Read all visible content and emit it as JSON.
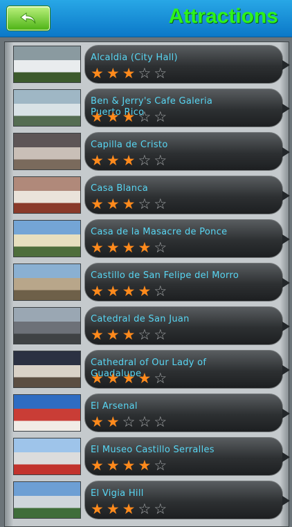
{
  "header": {
    "title": "Attractions",
    "back_icon": "back-arrow-icon"
  },
  "attractions": [
    {
      "name": "Alcaldia (City Hall)",
      "rating": 3,
      "thumb_icon": "photo-thumbnail"
    },
    {
      "name": "Ben & Jerry's Cafe Galeria Puerto Rico",
      "rating": 3,
      "thumb_icon": "photo-thumbnail"
    },
    {
      "name": "Capilla de Cristo",
      "rating": 3,
      "thumb_icon": "photo-thumbnail"
    },
    {
      "name": "Casa Blanca",
      "rating": 3,
      "thumb_icon": "photo-thumbnail"
    },
    {
      "name": "Casa de la Masacre de Ponce",
      "rating": 4,
      "thumb_icon": "photo-thumbnail"
    },
    {
      "name": "Castillo de San Felipe del Morro",
      "rating": 4,
      "thumb_icon": "photo-thumbnail"
    },
    {
      "name": "Catedral de San Juan",
      "rating": 3,
      "thumb_icon": "photo-thumbnail"
    },
    {
      "name": "Cathedral of Our Lady of Guadalupe",
      "rating": 4,
      "thumb_icon": "photo-thumbnail"
    },
    {
      "name": "El Arsenal",
      "rating": 2,
      "thumb_icon": "photo-thumbnail"
    },
    {
      "name": "El Museo Castillo Serralles",
      "rating": 4,
      "thumb_icon": "photo-thumbnail"
    },
    {
      "name": "El Vigia Hill",
      "rating": 3,
      "thumb_icon": "photo-thumbnail"
    }
  ],
  "rating_max": 5,
  "colors": {
    "header": "#1a8fd6",
    "title": "#2df21c",
    "back_button": "#7fd944",
    "name_text": "#58d6f3",
    "star_full": "#ff8a1c",
    "star_empty": "#a6a9ab"
  }
}
